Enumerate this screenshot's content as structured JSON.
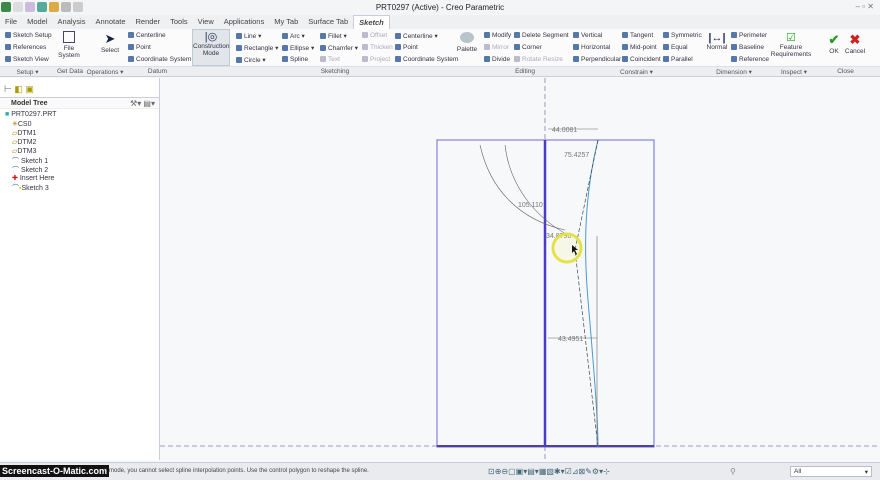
{
  "window": {
    "title": "PRT0297 (Active) - Creo Parametric"
  },
  "tabs": [
    "File",
    "Model",
    "Analysis",
    "Annotate",
    "Render",
    "Tools",
    "View",
    "Applications",
    "My Tab",
    "Surface Tab",
    "Sketch"
  ],
  "ribbon": {
    "setup": [
      "Sketch Setup",
      "References",
      "Sketch View"
    ],
    "file_system": "File System",
    "select": "Select",
    "datum": [
      "Centerline",
      "Point",
      "Coordinate System"
    ],
    "construction_mode": "Construction Mode",
    "sketching": [
      "Line",
      "Rectangle",
      "Circle",
      "Arc",
      "Ellipse",
      "Spline",
      "Fillet",
      "Chamfer",
      "Text",
      "Offset",
      "Thicken",
      "Project",
      "Centerline",
      "Point",
      "Coordinate System"
    ],
    "palette": "Palette",
    "editing": [
      "Modify",
      "Mirror",
      "Divide",
      "Delete Segment",
      "Corner",
      "Rotate Resize"
    ],
    "constrain": [
      "Vertical",
      "Horizontal",
      "Perpendicular",
      "Tangent",
      "Mid-point",
      "Coincident",
      "Symmetric",
      "Equal",
      "Parallel"
    ],
    "dimension": [
      "Normal",
      "Perimeter",
      "Baseline",
      "Reference"
    ],
    "inspect": "Feature Requirements",
    "ok": "OK",
    "cancel": "Cancel",
    "groups": [
      "Setup ▾",
      "Get Data",
      "Operations ▾",
      "Datum",
      "Sketching",
      "Editing",
      "Constrain ▾",
      "Dimension ▾",
      "Inspect ▾",
      "Close"
    ]
  },
  "model_tree": {
    "title": "Model Tree",
    "items": [
      "PRT0297.PRT",
      "CS0",
      "DTM1",
      "DTM2",
      "DTM3",
      "Sketch 1",
      "Sketch 2",
      "Insert Here",
      "Sketch 3"
    ]
  },
  "dimensions": [
    "44.0081",
    "75.4257",
    "105.110",
    "34.8796",
    "43.4951"
  ],
  "status": {
    "message": "n mode, you cannot select spline interpolation points. Use the control polygon to reshape the spline.",
    "filter": "All",
    "watermark": "Screencast-O-Matic.com"
  }
}
